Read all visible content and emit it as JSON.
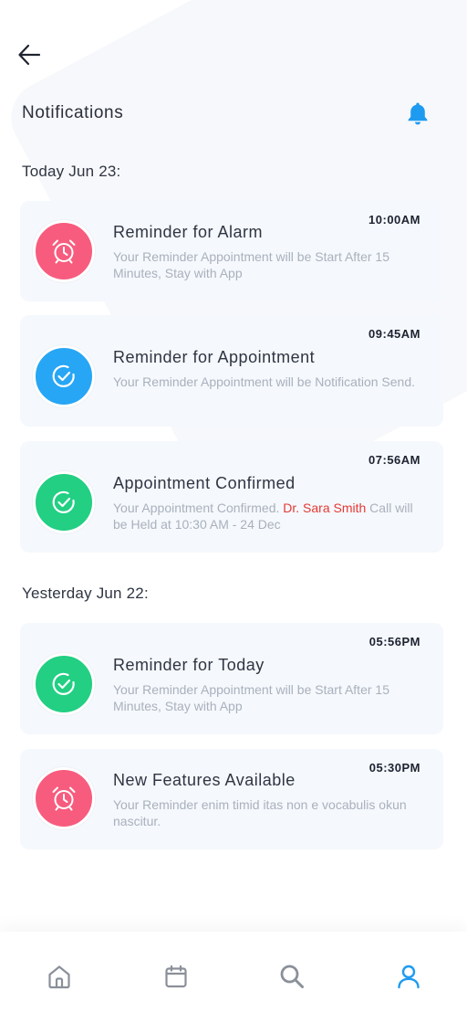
{
  "header": {
    "title": "Notifications"
  },
  "colors": {
    "accent": "#1e9bf0",
    "alarm": "#f75c7e",
    "appointment": "#27a6f5",
    "confirmed": "#22cf83",
    "nav_inactive": "#8a9099"
  },
  "sections": [
    {
      "title": "Today Jun 23:"
    },
    {
      "title": "Yesterday Jun 22:"
    }
  ],
  "notifications": [
    {
      "time": "10:00AM",
      "title": "Reminder for Alarm",
      "description": "Your Reminder Appointment will be Start After 15 Minutes, Stay with App",
      "icon": "alarm-clock-icon"
    },
    {
      "time": "09:45AM",
      "title": "Reminder for Appointment",
      "description": "Your Reminder Appointment will be Notification Send.",
      "icon": "check-circle-icon"
    },
    {
      "time": "07:56AM",
      "title": "Appointment Confirmed",
      "description_before": "Your Appointment Confirmed. ",
      "description_highlight": "Dr. Sara Smith",
      "description_after": " Call will be Held at 10:30 AM - 24 Dec",
      "icon": "check-circle-icon"
    },
    {
      "time": "05:56PM",
      "title": "Reminder for Today",
      "description": "Your Reminder Appointment will be Start After 15 Minutes, Stay with App",
      "icon": "check-circle-icon"
    },
    {
      "time": "05:30PM",
      "title": "New Features Available",
      "description": "Your Reminder enim timid itas non e vocabulis okun nascitur.",
      "icon": "alarm-clock-icon"
    }
  ],
  "bottom_nav": [
    {
      "icon": "home-icon",
      "active": false
    },
    {
      "icon": "calendar-icon",
      "active": false
    },
    {
      "icon": "search-icon",
      "active": false
    },
    {
      "icon": "user-icon",
      "active": true
    }
  ]
}
